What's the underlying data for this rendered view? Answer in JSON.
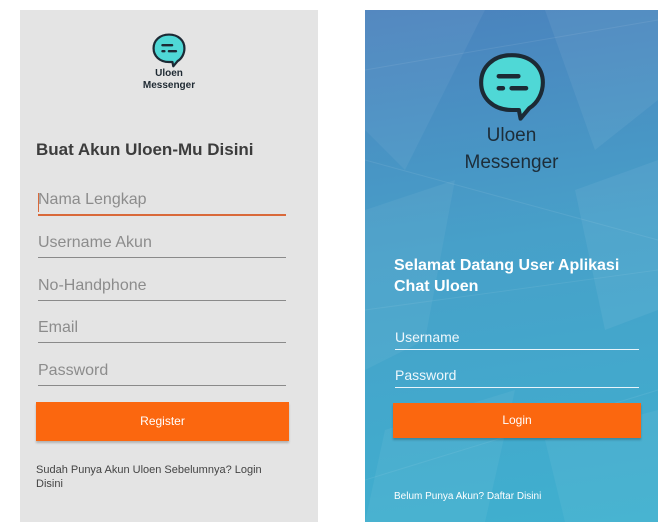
{
  "register": {
    "logo": {
      "icon": "chat-bubble-icon",
      "line1": "Uloen",
      "line2": "Messenger"
    },
    "title": "Buat Akun Uloen-Mu Disini",
    "fields": {
      "full_name": "Nama Lengkap",
      "username": "Username Akun",
      "phone": "No-Handphone",
      "email": "Email",
      "password": "Password"
    },
    "register_button": "Register",
    "footer_link": "Sudah Punya Akun Uloen Sebelumnya? Login Disini"
  },
  "login": {
    "logo": {
      "icon": "chat-bubble-icon",
      "line1": "Uloen",
      "line2": "Messenger"
    },
    "welcome": "Selamat Datang User Aplikasi Chat Uloen",
    "fields": {
      "username": "Username",
      "password": "Password"
    },
    "login_button": "Login",
    "footer_link": "Belum Punya Akun? Daftar Disini"
  },
  "colors": {
    "accent": "#fb670f",
    "logo_fill": "#4fd8d6",
    "register_bg": "#e4e4e4",
    "login_bg": "#47a0c9"
  }
}
